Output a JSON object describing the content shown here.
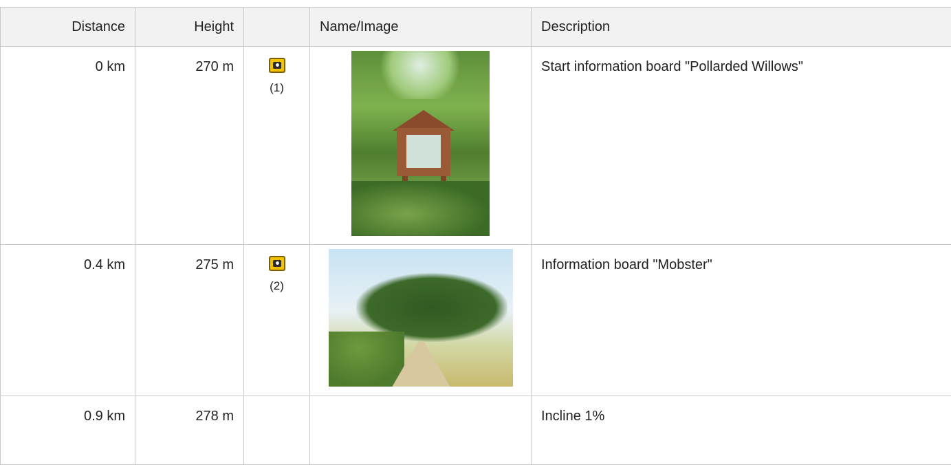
{
  "table": {
    "headers": {
      "distance": "Distance",
      "height": "Height",
      "icon": "",
      "name_image": "Name/Image",
      "description": "Description"
    },
    "rows": [
      {
        "distance": "0 km",
        "height": "270 m",
        "icon": "photo-icon",
        "ref": "(1)",
        "image": "information board in woodland",
        "description": "Start information board \"Pollarded Willows\""
      },
      {
        "distance": "0.4 km",
        "height": "275 m",
        "icon": "photo-icon",
        "ref": "(2)",
        "image": "country path with trees",
        "description": "Information board \"Mobster\""
      },
      {
        "distance": "0.9 km",
        "height": "278 m",
        "icon": "",
        "ref": "",
        "image": "",
        "description": "Incline 1%"
      }
    ]
  },
  "colors": {
    "header_bg": "#f2f2f2",
    "border": "#c8c8c8",
    "icon_yellow": "#f2c200"
  }
}
